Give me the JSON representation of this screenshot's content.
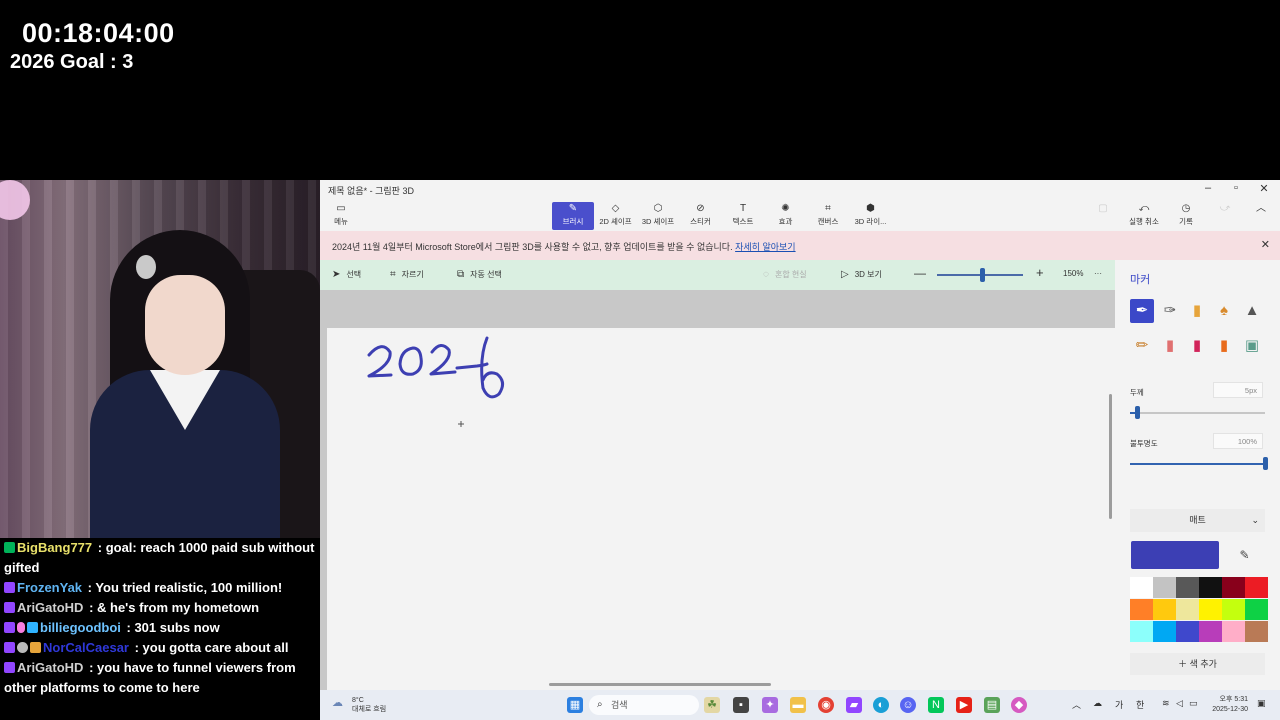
{
  "overlay": {
    "timer": "00:18:04:00",
    "goal": "2026 Goal : 3"
  },
  "chat": [
    {
      "badges": [
        "green"
      ],
      "user": "BigBang777",
      "user_color": "#e8e06a",
      "text": " : goal: reach 1000 paid sub without gifted"
    },
    {
      "badges": [
        "purple"
      ],
      "user": "FrozenYak",
      "user_color": "#5fb4f2",
      "text": " : You tried realistic, 100 million!"
    },
    {
      "badges": [
        "purple"
      ],
      "user": "AriGatoHD",
      "user_color": "#d0d0d0",
      "text": " : & he's from my hometown"
    },
    {
      "badges": [
        "purple",
        "pink",
        "blue"
      ],
      "user": "billiegoodboi",
      "user_color": "#6ec3ff",
      "text": " : 301 subs now"
    },
    {
      "badges": [
        "purple",
        "gray",
        "gold"
      ],
      "user": "NorCalCaesar",
      "user_color": "#2f38d8",
      "text": " : you gotta care about all"
    },
    {
      "badges": [
        "purple"
      ],
      "user": "AriGatoHD",
      "user_color": "#d0d0d0",
      "text": " : you have to funnel viewers from other platforms to come to here"
    }
  ],
  "app": {
    "title": "제목 없음* - 그림판 3D",
    "menu_label": "메뉴",
    "ribbon": [
      {
        "icon": "✎",
        "label": "브러시",
        "active": true
      },
      {
        "icon": "◇",
        "label": "2D 셰이프"
      },
      {
        "icon": "⬡",
        "label": "3D 셰이프"
      },
      {
        "icon": "⊘",
        "label": "스티커"
      },
      {
        "icon": "T",
        "label": "텍스트"
      },
      {
        "icon": "✺",
        "label": "효과"
      },
      {
        "icon": "⌗",
        "label": "캔버스"
      },
      {
        "icon": "⬢",
        "label": "3D 라이..."
      }
    ],
    "right_ribbon": [
      {
        "icon": "⤺",
        "label": "실행 취소"
      },
      {
        "icon": "◷",
        "label": "기록"
      }
    ],
    "banner_text": "2024년 11월 4일부터 Microsoft Store에서 그림판 3D를 사용할 수 없고, 향후 업데이트를 받을 수 없습니다.",
    "banner_link": "자세히 알아보기",
    "toolbar": {
      "select": "선택",
      "crop": "자르기",
      "magic_select": "자동 선택",
      "mixed_reality": "혼합 현실",
      "view3d": "3D 보기",
      "zoom": "150%"
    },
    "side": {
      "title": "마커",
      "thickness_label": "두께",
      "thickness_value": "5px",
      "thickness_level": 0.05,
      "opacity_label": "불투명도",
      "opacity_value": "100%",
      "opacity_level": 1.0,
      "finish": "매트",
      "add_color": "색 추가",
      "current_color": "#3c3fb4",
      "palette": [
        "#ffffff",
        "#c3c3c3",
        "#585858",
        "#111111",
        "#88001b",
        "#ec1c24",
        "#ff7f27",
        "#ffc90e",
        "#eee79c",
        "#fff200",
        "#c4ff0e",
        "#0ed145",
        "#8cfffb",
        "#00a8f3",
        "#3f48cc",
        "#b83dba",
        "#ffaec8",
        "#b97a56"
      ]
    }
  },
  "taskbar": {
    "weather_temp": "8°C",
    "weather_desc": "대체로 흐림",
    "search": "검색",
    "time": "오후 5:31",
    "date": "2025-12-30",
    "ime1": "가",
    "ime2": "한"
  }
}
